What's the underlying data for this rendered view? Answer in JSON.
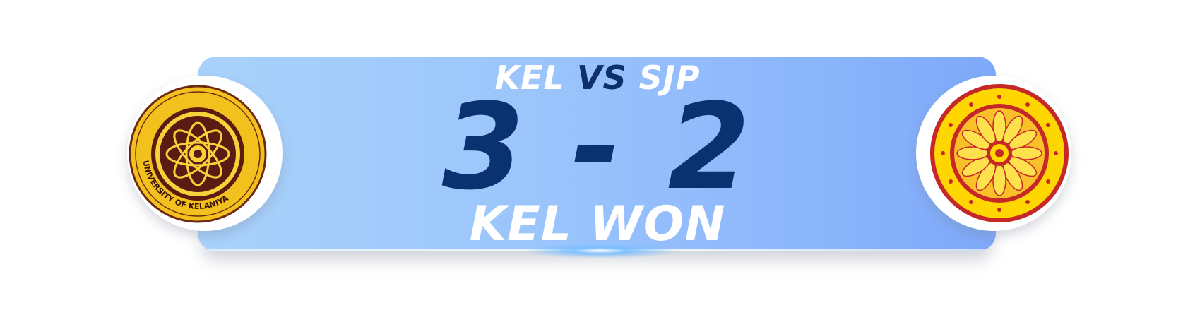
{
  "match": {
    "team_a": "KEL",
    "vs": "VS",
    "team_b": "SJP",
    "score_a": "3",
    "separator": "-",
    "score_b": "2",
    "result": "KEL WON"
  },
  "logos": {
    "left": {
      "name": "University of Kelaniya seal",
      "text": "UNIVERSITY OF KELANIYA",
      "colors": {
        "ring": "#f3c11d",
        "inner": "#5b1a12",
        "motif": "#f6d23a"
      }
    },
    "right": {
      "name": "University of Sri Jayewardenepura seal",
      "colors": {
        "ring": "#c62828",
        "band": "#ffd600",
        "motif": "#f9a825"
      }
    }
  },
  "colors": {
    "banner_start": "#a9d2fb",
    "banner_end": "#7ea9f9",
    "score": "#0b3270",
    "accent_text": "#ffffff"
  }
}
